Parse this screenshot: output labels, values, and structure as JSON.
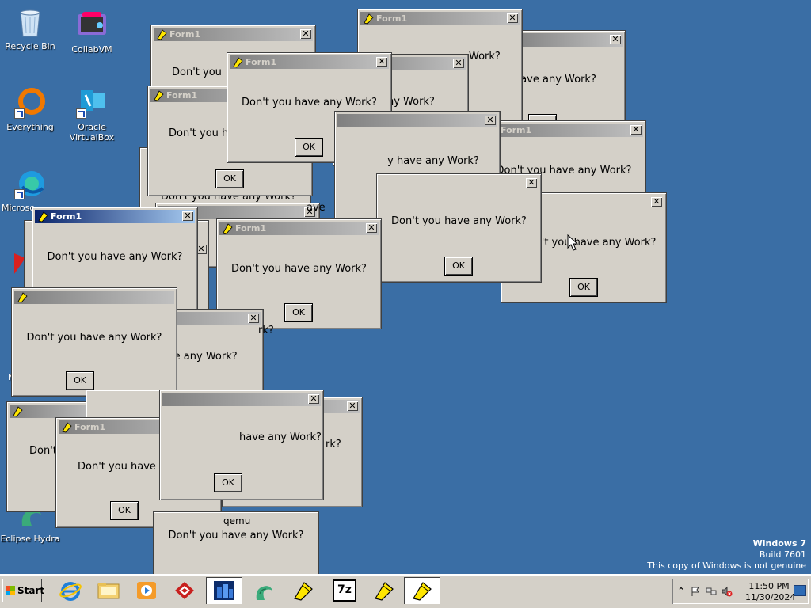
{
  "desktop": {
    "icons": [
      {
        "label": "Recycle Bin"
      },
      {
        "label": "CollabVM"
      },
      {
        "label": "Everything"
      },
      {
        "label": "Oracle VirtualBox"
      },
      {
        "label": "Microso"
      },
      {
        "label": "N"
      },
      {
        "label": "Eclipse Hydra"
      }
    ]
  },
  "dialog": {
    "title": "Form1",
    "message": "Don't you have any Work?",
    "ok_label": "OK",
    "close_glyph": "✕"
  },
  "partials": {
    "m1": "Work?",
    "m2": "y have any Work?",
    "m3": "Don't you ha",
    "m4": "have any Work?",
    "m5": "Don't you have a",
    "m6": "ave",
    "m7": "Don't you",
    "m8": "have any Work?",
    "m9": "rk?",
    "m10": "ave any Work?",
    "m11": "any Work?",
    "m12": "rk?",
    "m13": "Don't you have an",
    "m14": "Don't y",
    "m15": "Don't you have any Work?",
    "m16": "Don't you have any Work?",
    "m17": "n't you have any Work?",
    "m18": "Don't you have any Work?",
    "m19": "Don't you have any Work?",
    "m20": "Don't you have any Work?",
    "m21": "Don't you have any Work?",
    "qemu": "qemu"
  },
  "watermark": {
    "line1": "Windows 7",
    "line2": "Build 7601",
    "line3": "This copy of Windows is not genuine"
  },
  "taskbar": {
    "start_label": "Start",
    "apps": [
      "internet-explorer",
      "file-explorer",
      "media-player",
      "app-red-logo",
      "app-blue-building",
      "eclipse-hydra",
      "form1-app",
      "7zip",
      "form1-app",
      "form1-app"
    ],
    "sevenzip_label": "7z",
    "tray": {
      "chevron": "⌃",
      "time": "11:50 PM",
      "date": "11/30/2024"
    }
  }
}
